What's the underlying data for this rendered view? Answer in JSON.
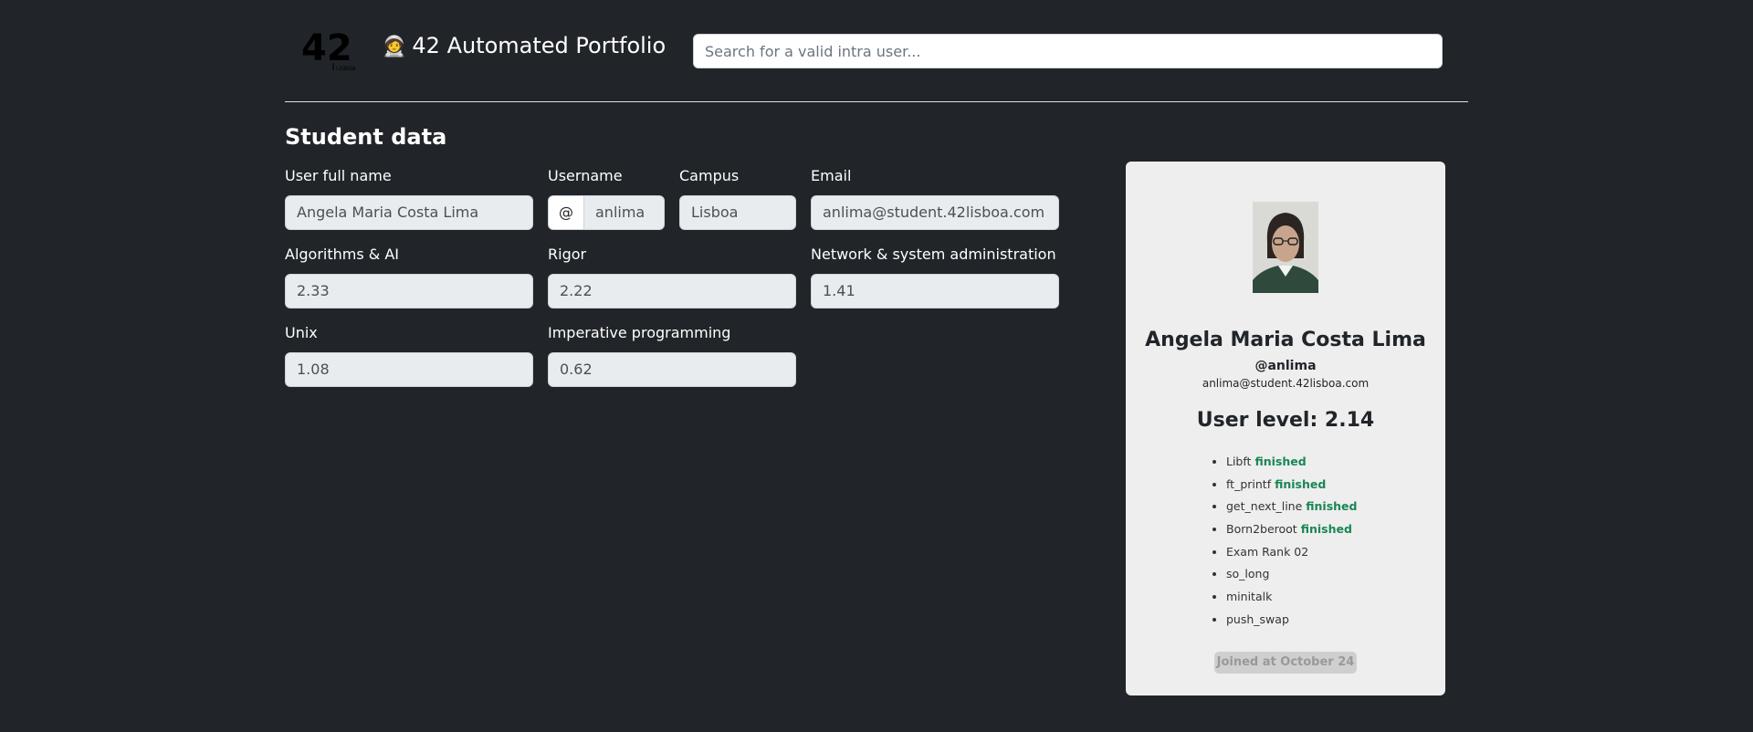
{
  "header": {
    "logo_text": "42",
    "logo_subtext": "LISBOA",
    "brand_emoji": "🧑‍🚀",
    "brand_title": "42 Automated Portfolio",
    "search_placeholder": "Search for a valid intra user..."
  },
  "student": {
    "section_title": "Student data",
    "fields": {
      "full_name": {
        "label": "User full name",
        "value": "Angela Maria Costa Lima"
      },
      "username": {
        "label": "Username",
        "prefix": "@",
        "value": "anlima"
      },
      "campus": {
        "label": "Campus",
        "value": "Lisboa"
      },
      "email": {
        "label": "Email",
        "value": "anlima@student.42lisboa.com"
      },
      "algorithms": {
        "label": "Algorithms & AI",
        "value": "2.33"
      },
      "rigor": {
        "label": "Rigor",
        "value": "2.22"
      },
      "network": {
        "label": "Network & system administration",
        "value": "1.41"
      },
      "unix": {
        "label": "Unix",
        "value": "1.08"
      },
      "imperative": {
        "label": "Imperative programming",
        "value": "0.62"
      }
    }
  },
  "card": {
    "name": "Angela Maria Costa Lima",
    "login": "@anlima",
    "email": "anlima@student.42lisboa.com",
    "level": "User level: 2.14",
    "projects": [
      {
        "name": "Libft",
        "status": "finished"
      },
      {
        "name": "ft_printf",
        "status": "finished"
      },
      {
        "name": "get_next_line",
        "status": "finished"
      },
      {
        "name": "Born2beroot",
        "status": "finished"
      },
      {
        "name": "Exam Rank 02",
        "status": ""
      },
      {
        "name": "so_long",
        "status": ""
      },
      {
        "name": "minitalk",
        "status": ""
      },
      {
        "name": "push_swap",
        "status": ""
      }
    ],
    "joined": "Joined at October 24",
    "status_color": "#198754"
  },
  "colors": {
    "background": "#212529",
    "card": "#eeeeee",
    "input_disabled": "#e9ecef"
  }
}
